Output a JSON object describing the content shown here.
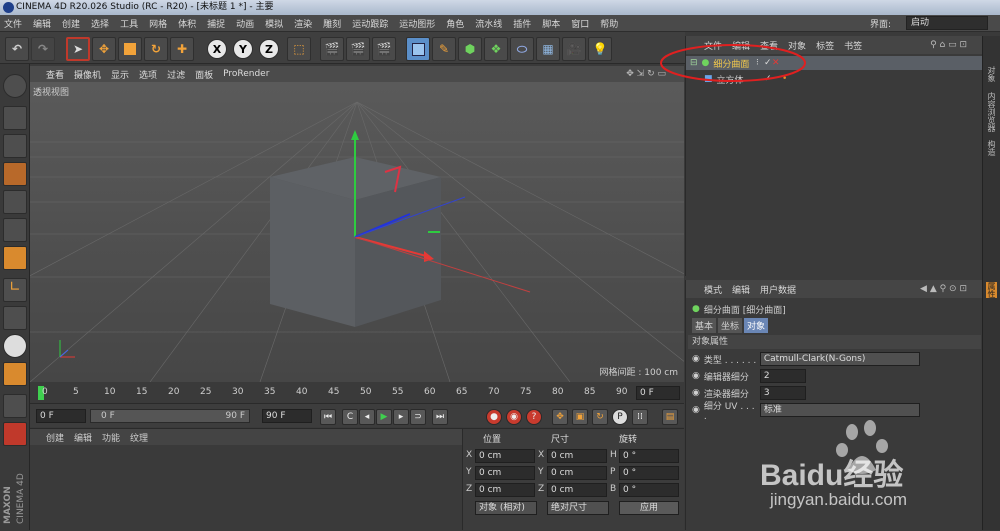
{
  "window": {
    "title": "CINEMA 4D R20.026 Studio (RC - R20) - [未标题 1 *] - 主要"
  },
  "menubar": {
    "items": [
      "文件",
      "编辑",
      "创建",
      "选择",
      "工具",
      "网格",
      "体积",
      "捕捉",
      "动画",
      "模拟",
      "渲染",
      "雕刻",
      "运动跟踪",
      "运动图形",
      "角色",
      "流水线",
      "插件",
      "脚本",
      "窗口",
      "帮助"
    ],
    "interface_label": "界面:",
    "interface_value": "启动"
  },
  "toolbar": {
    "x_label": "X",
    "y_label": "Y",
    "z_label": "Z"
  },
  "viewport": {
    "menu": [
      "查看",
      "摄像机",
      "显示",
      "选项",
      "过滤",
      "面板",
      "ProRender"
    ],
    "name": "透视视图",
    "grid_spacing": "网格间距 : 100 cm"
  },
  "timeline": {
    "ticks": [
      "0",
      "5",
      "10",
      "15",
      "20",
      "25",
      "30",
      "35",
      "40",
      "45",
      "50",
      "55",
      "60",
      "65",
      "70",
      "75",
      "80",
      "85",
      "90"
    ],
    "frame_field": "0 F"
  },
  "transport": {
    "start_field": "0 F",
    "range_start": "0 F",
    "range_end": "90 F",
    "end_field": "90 F"
  },
  "material_panel": {
    "menu": [
      "创建",
      "编辑",
      "功能",
      "纹理"
    ]
  },
  "coord_panel": {
    "headers": [
      "位置",
      "尺寸",
      "旋转"
    ],
    "rows": [
      {
        "a": "X",
        "a_val": "0 cm",
        "b": "X",
        "b_val": "0 cm",
        "c": "H",
        "c_val": "0 °"
      },
      {
        "a": "Y",
        "a_val": "0 cm",
        "b": "Y",
        "b_val": "0 cm",
        "c": "P",
        "c_val": "0 °"
      },
      {
        "a": "Z",
        "a_val": "0 cm",
        "b": "Z",
        "b_val": "0 cm",
        "c": "B",
        "c_val": "0 °"
      }
    ],
    "mode1": "对象 (相对)",
    "mode2": "绝对尺寸",
    "apply": "应用"
  },
  "object_panel": {
    "menu": [
      "文件",
      "编辑",
      "查看",
      "对象",
      "标签",
      "书签"
    ],
    "objects": [
      {
        "name": "细分曲面",
        "selected": true
      },
      {
        "name": "立方体",
        "selected": false
      }
    ]
  },
  "attr_panel": {
    "menu": [
      "模式",
      "编辑",
      "用户数据"
    ],
    "object_title": "细分曲面 [细分曲面]",
    "tabs": [
      "基本",
      "坐标",
      "对象"
    ],
    "active_tab": "对象",
    "section": "对象属性",
    "props": [
      {
        "label": "类型 . . . . . .",
        "value": "Catmull-Clark(N-Gons)"
      },
      {
        "label": "编辑器细分",
        "value": "2"
      },
      {
        "label": "渲染器细分",
        "value": "3"
      },
      {
        "label": "细分 UV . . . .",
        "value": "标准"
      }
    ]
  },
  "right_tabs": [
    "对象",
    "内容浏览器",
    "构造",
    "属性"
  ],
  "brand": {
    "maxon": "MAXON",
    "cinema": "CINEMA 4D"
  },
  "watermark": {
    "text": "Baidu经验",
    "url": "jingyan.baidu.com"
  },
  "colors": {
    "accent": "#d43a2c",
    "selected_row": "#5a5f66",
    "ui_bg": "#3a3a3a"
  }
}
